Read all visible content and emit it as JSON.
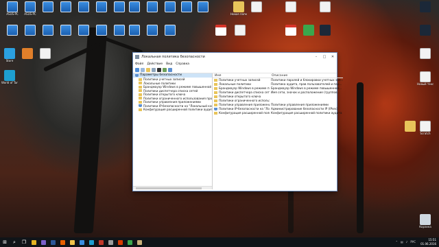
{
  "desktop": {
    "icons_top_row": [
      {
        "label": "ASUS-PC",
        "glyph": "g-pc"
      },
      {
        "label": "ASUS-PC",
        "glyph": "g-pc"
      },
      {
        "label": "",
        "glyph": "g-pc"
      },
      {
        "label": "",
        "glyph": "g-pc"
      },
      {
        "label": "",
        "glyph": "g-pc"
      },
      {
        "label": "",
        "glyph": "g-pc"
      },
      {
        "label": "",
        "glyph": "g-pc"
      },
      {
        "label": "",
        "glyph": "g-pc"
      },
      {
        "label": "",
        "glyph": "g-pc"
      },
      {
        "label": "",
        "glyph": "g-pc"
      },
      {
        "label": "",
        "glyph": "g-pc"
      },
      {
        "label": "",
        "glyph": "g-pc"
      },
      {
        "label": "Новая папка",
        "glyph": "g-folder"
      },
      {
        "label": "",
        "glyph": "g-doc"
      },
      {
        "label": "",
        "glyph": "g-doc"
      },
      {
        "label": "",
        "glyph": "g-doc"
      }
    ],
    "icons_second_row": [
      {
        "label": "",
        "glyph": "g-pc"
      },
      {
        "label": "",
        "glyph": "g-pc"
      },
      {
        "label": "",
        "glyph": "g-pc"
      },
      {
        "label": "",
        "glyph": "g-pc"
      },
      {
        "label": "",
        "glyph": "g-pc"
      },
      {
        "label": "",
        "glyph": "g-pc"
      },
      {
        "label": "",
        "glyph": "g-pc"
      },
      {
        "label": "",
        "glyph": "g-pc"
      },
      {
        "label": "",
        "glyph": "g-pc"
      },
      {
        "label": "",
        "glyph": "g-pc"
      },
      {
        "label": "",
        "glyph": "g-pdf"
      },
      {
        "label": "",
        "glyph": "g-doc"
      },
      {
        "label": "",
        "glyph": "g-pdf"
      },
      {
        "label": "",
        "glyph": "g-green"
      },
      {
        "label": "",
        "glyph": "g-steam"
      }
    ],
    "left_icons": [
      {
        "label": "Store",
        "glyph": "g-store"
      },
      {
        "label": "",
        "glyph": "g-orange"
      },
      {
        "label": "",
        "glyph": "g-doc"
      },
      {
        "label": "World of Tanks",
        "glyph": "g-teal"
      }
    ],
    "right_icons": [
      {
        "label": "",
        "glyph": "g-steam"
      },
      {
        "label": "",
        "glyph": "g-steam"
      },
      {
        "label": "",
        "glyph": "g-doc"
      },
      {
        "label": "Новый текстов...",
        "glyph": "g-doc"
      },
      {
        "label": "",
        "glyph": "g-folder"
      },
      {
        "label": "Scratch",
        "glyph": "g-doc"
      },
      {
        "label": "Корзина",
        "glyph": "g-bin"
      }
    ]
  },
  "window": {
    "title": "Локальная политика безопасности",
    "controls": {
      "minimize": "–",
      "maximize": "□",
      "close": "✕"
    },
    "menu": [
      "Файл",
      "Действие",
      "Вид",
      "Справка"
    ],
    "tree": {
      "root": "Параметры безопасности",
      "items": [
        {
          "label": "Политики учетных записей",
          "icon": "folder"
        },
        {
          "label": "Локальные политики",
          "icon": "folder"
        },
        {
          "label": "Брандмауэр Windows в режиме повышенной безопасности",
          "icon": "folder"
        },
        {
          "label": "Политики диспетчера списка сетей",
          "icon": "folder"
        },
        {
          "label": "Политики открытого ключа",
          "icon": "folder"
        },
        {
          "label": "Политики ограниченного использования программ",
          "icon": "folder"
        },
        {
          "label": "Политики управления приложениями",
          "icon": "folder"
        },
        {
          "label": "Политики IP-безопасности на \"Локальный компьютер\"",
          "icon": "shield"
        },
        {
          "label": "Конфигурация расширенной политики аудита",
          "icon": "folder"
        }
      ]
    },
    "list": {
      "columns": [
        "Имя",
        "Описание"
      ],
      "rows": [
        {
          "name": "Политики учетных записей",
          "desc": "Политики паролей и блокировки учетных зап...",
          "icon": "folder"
        },
        {
          "name": "Локальные политики",
          "desc": "Политика аудита, прав пользователей и пар...",
          "icon": "folder"
        },
        {
          "name": "Брандмауэр Windows в режиме повыш...",
          "desc": "Брандмауэр Windows в режиме повышенной...",
          "icon": "folder"
        },
        {
          "name": "Политики диспетчера списка сетей",
          "desc": "Имя сети, значок и расположение (группов...",
          "icon": "folder"
        },
        {
          "name": "Политики открытого ключа",
          "desc": "",
          "icon": "folder"
        },
        {
          "name": "Политики ограниченного использова...",
          "desc": "",
          "icon": "folder"
        },
        {
          "name": "Политики управления приложениями",
          "desc": "Политики управления приложениями",
          "icon": "folder"
        },
        {
          "name": "Политики IP-безопасности на \"Локаль...",
          "desc": "Администрирование безопасности IP (IPsec)",
          "icon": "shield"
        },
        {
          "name": "Конфигурация расширенной политики...",
          "desc": "Конфигурация расширенной политики аудита",
          "icon": "folder"
        }
      ]
    }
  },
  "taskbar": {
    "start_glyph": "⊞",
    "search_glyph": "⌕",
    "task_view_glyph": "❐",
    "pinned": [
      {
        "name": "chrome-taskbar-button",
        "color": "#e4b422"
      },
      {
        "name": "viber-taskbar-button",
        "color": "#7b5fc9"
      },
      {
        "name": "word-taskbar-button",
        "color": "#2b5797"
      },
      {
        "name": "firefox-taskbar-button",
        "color": "#e66000"
      },
      {
        "name": "explorer-taskbar-button",
        "color": "#f0c24a"
      },
      {
        "name": "app-taskbar-button-1",
        "color": "#3a8de0"
      },
      {
        "name": "app-taskbar-button-2",
        "color": "#1e9fd0"
      },
      {
        "name": "app-taskbar-button-3",
        "color": "#c0392b"
      },
      {
        "name": "app-taskbar-button-4",
        "color": "#9c9c9c"
      },
      {
        "name": "app-taskbar-button-5",
        "color": "#d83b01"
      },
      {
        "name": "app-taskbar-button-6",
        "color": "#3aa64c"
      },
      {
        "name": "secpol-taskbar-button",
        "color": "#c8b07a"
      }
    ],
    "tray_language": "РУС",
    "time": "15:51",
    "date": "01.06.2016"
  }
}
